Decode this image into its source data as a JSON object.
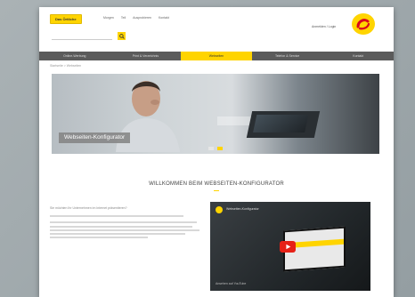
{
  "header": {
    "brand_label": "Das Örtliche",
    "top_nav": [
      "Morgen",
      "Teil",
      "Ausprobieren",
      "Kontakt"
    ],
    "login_label": "Anmelden / Login",
    "search_icon": "search-icon",
    "logo_icon": "brand-logo-icon"
  },
  "nav": {
    "items": [
      {
        "label": "Online-Werbung"
      },
      {
        "label": "Print & Verzeichnis"
      },
      {
        "label": "Webseiten",
        "active": true
      },
      {
        "label": "Telefon & Service"
      },
      {
        "label": "Kontakt"
      }
    ]
  },
  "breadcrumb": "Startseite > Webseiten",
  "hero": {
    "caption": "Webseiten-Konfigurator"
  },
  "welcome": {
    "title": "WILLKOMMEN BEIM WEBSEITEN-KONFIGURATOR"
  },
  "body": {
    "lead": "Sie möchten Ihr Unternehmen im Internet präsentieren?"
  },
  "video": {
    "title": "Webseiten-Konfigurator",
    "footer": "Ansehen auf YouTube",
    "play_icon": "play-icon"
  },
  "colors": {
    "accent": "#ffd400",
    "nav_bg": "#5b5b5b",
    "play_red": "#e62117"
  }
}
